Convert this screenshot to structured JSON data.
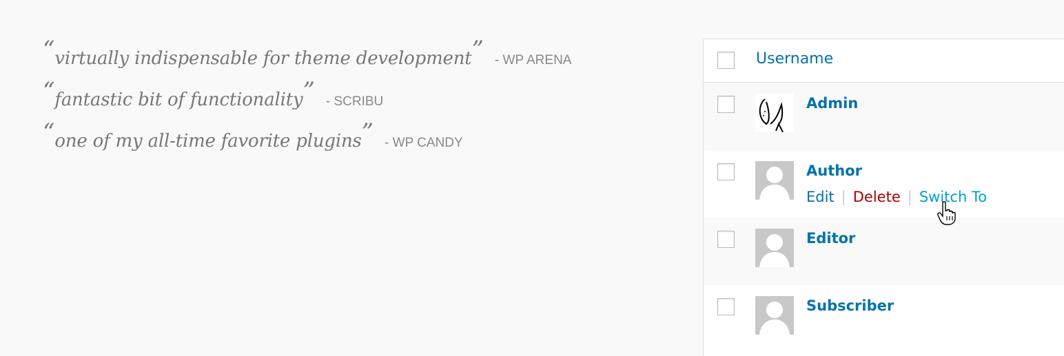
{
  "quotes": [
    {
      "text": "virtually indispensable for theme development",
      "source": "- WP ARENA"
    },
    {
      "text": "fantastic bit of functionality",
      "source": "- SCRIBU"
    },
    {
      "text": "one of my all-time favorite plugins",
      "source": "- WP CANDY"
    }
  ],
  "table": {
    "header": {
      "label": "Username"
    },
    "rows": [
      {
        "username": "Admin",
        "avatar": "sketch-avatar"
      },
      {
        "username": "Author",
        "avatar": "default-avatar",
        "actions": {
          "edit": "Edit",
          "delete": "Delete",
          "switch_to": "Switch To"
        }
      },
      {
        "username": "Editor",
        "avatar": "default-avatar"
      },
      {
        "username": "Subscriber",
        "avatar": "default-avatar"
      }
    ]
  },
  "colors": {
    "link": "#0073aa",
    "delete": "#aa0000",
    "switch_hover": "#00a0d2",
    "quote_text": "#777777"
  },
  "icons": {
    "cursor": "hand-pointer-icon",
    "avatar_placeholder": "person-silhouette-icon"
  }
}
